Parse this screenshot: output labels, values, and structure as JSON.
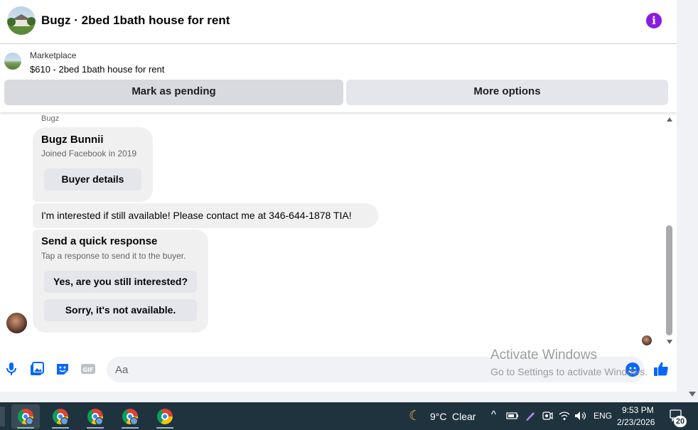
{
  "header": {
    "title": "Bugz · 2bed 1bath house for rent",
    "info_icon": "info-icon",
    "info_glyph": "i",
    "accent_color": "#8a1be0"
  },
  "listing": {
    "source": "Marketplace",
    "title": "$610 - 2bed 1bath house for rent",
    "mark_pending_label": "Mark as pending",
    "more_options_label": "More options"
  },
  "messages": {
    "sender_name": "Bugz",
    "profile_card": {
      "name": "Bugz Bunnii",
      "subtitle": "Joined Facebook in 2019",
      "button_label": "Buyer details"
    },
    "message_text": "I'm interested if still available! Please contact me at 346-644-1878 TIA!",
    "quick_response": {
      "title": "Send a quick response",
      "subtitle": "Tap a response to send it to the buyer.",
      "options": [
        "Yes, are you still interested?",
        "Sorry, it's not available."
      ]
    }
  },
  "composer": {
    "placeholder": "Aa",
    "icons": [
      "microphone-icon",
      "photo-icon",
      "sticker-icon",
      "gif-icon",
      "emoji-icon",
      "like-icon"
    ],
    "gif_label": "GIF",
    "accent_color": "#0866ff"
  },
  "watermark": {
    "line1": "Activate Windows",
    "line2": "Go to Settings to activate Windows."
  },
  "taskbar": {
    "weather_temp": "9°C",
    "weather_desc": "Clear",
    "language": "ENG",
    "time": "9:53 PM",
    "date": "2/23/2026",
    "notification_count": "20",
    "chevron_glyph": "^",
    "apps": [
      "chrome-icon",
      "chrome-icon",
      "chrome-icon",
      "chrome-icon",
      "chrome-icon"
    ]
  }
}
